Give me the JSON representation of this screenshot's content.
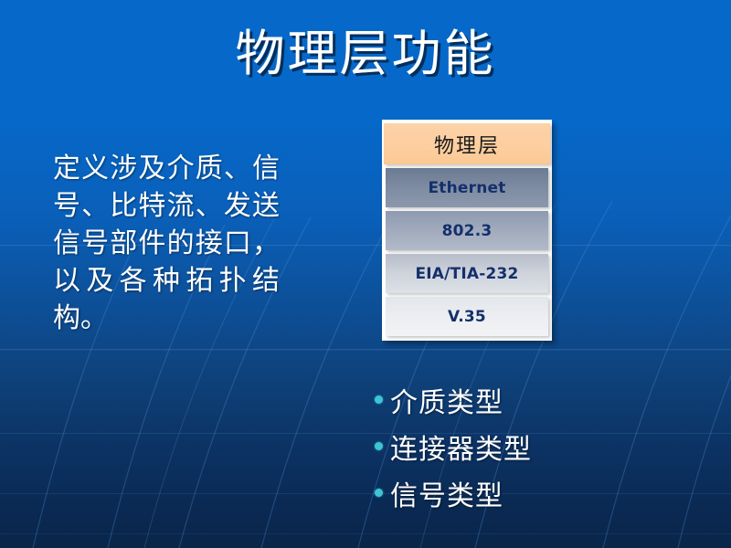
{
  "slide": {
    "title": "物理层功能",
    "body_text": "定义涉及介质、信号、比特流、发送信号部件的接口，以及各种拓扑结构。",
    "background_top_color": "#0669ca",
    "background_bottom_color": "#092549",
    "title_color": "#ffffff",
    "text_color": "#ffffff",
    "bullet_dot_color": "#3ec5d4"
  },
  "stack": {
    "frame_color": "#ffffff",
    "rows": [
      {
        "label": "物理层",
        "style": "highlight",
        "fill": "#fbcf9f",
        "text_color": "#1a1a1a"
      },
      {
        "label": "Ethernet",
        "style": "normal",
        "fill": "#7e8ca2",
        "text_color": "#14306b"
      },
      {
        "label": "802.3",
        "style": "normal",
        "fill": "#a1abbd",
        "text_color": "#14306b"
      },
      {
        "label": "EIA/TIA-232",
        "style": "normal",
        "fill": "#ced3dc",
        "text_color": "#14306b"
      },
      {
        "label": "V.35",
        "style": "normal",
        "fill": "#eceef1",
        "text_color": "#14306b"
      }
    ]
  },
  "bullets": {
    "items": [
      {
        "label": "介质类型"
      },
      {
        "label": "连接器类型"
      },
      {
        "label": "信号类型"
      }
    ]
  }
}
